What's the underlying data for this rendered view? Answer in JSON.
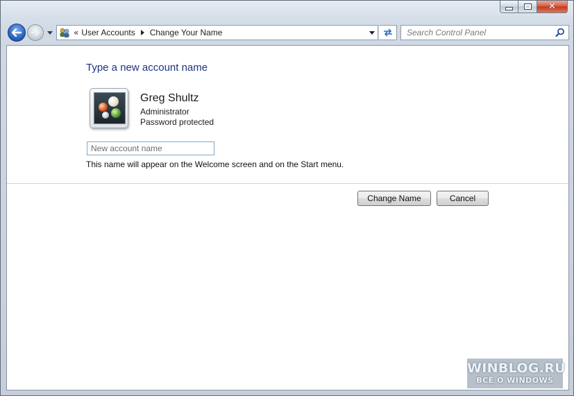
{
  "breadcrumb": {
    "items": [
      "User Accounts",
      "Change Your Name"
    ]
  },
  "search": {
    "placeholder": "Search Control Panel"
  },
  "main": {
    "heading": "Type a new account name",
    "user": {
      "name": "Greg Shultz",
      "role": "Administrator",
      "status": "Password protected"
    },
    "name_input_placeholder": "New account name",
    "hint": "This name will appear on the Welcome screen and on the Start menu.",
    "change_button": "Change Name",
    "cancel_button": "Cancel"
  },
  "watermark": {
    "line1": "WINBLOG.RU",
    "line2": "ВСЁ О WINDOWS"
  },
  "icons": {
    "back": "back-arrow-icon",
    "forward": "forward-arrow-icon",
    "recent_pages": "chevron-down-icon",
    "location": "user-accounts-icon",
    "address_dropdown": "chevron-down-icon",
    "refresh": "refresh-icon",
    "search": "search-icon",
    "minimize": "minimize-icon",
    "maximize": "maximize-icon",
    "close": "close-icon"
  },
  "colors": {
    "heading": "#1e3287",
    "close_button": "#c0391b",
    "back_button": "#2a64c0"
  }
}
